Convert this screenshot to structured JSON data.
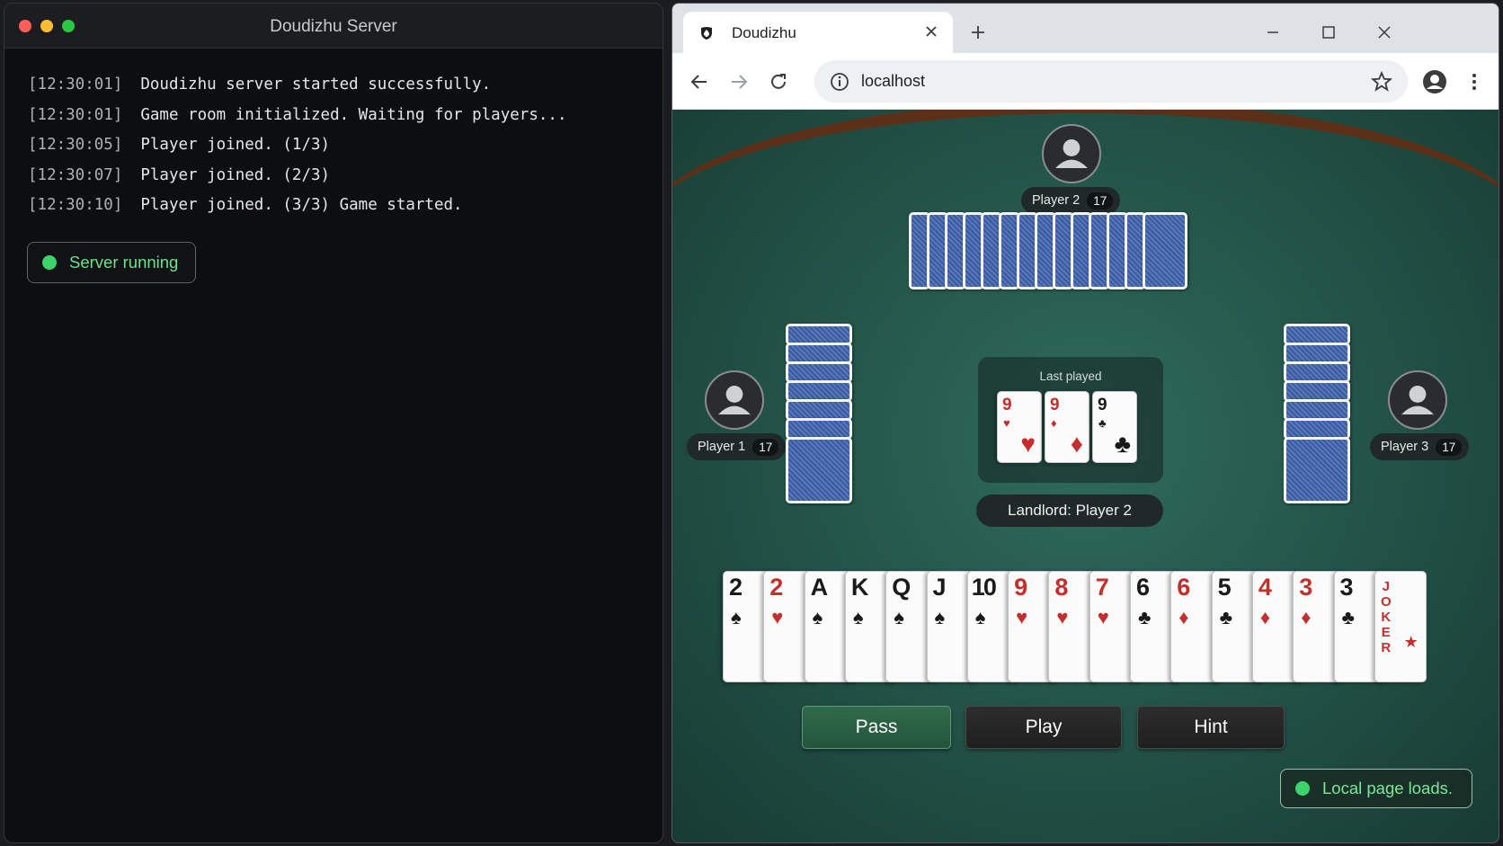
{
  "terminal": {
    "title": "Doudizhu Server",
    "log": [
      {
        "time": "[12:30:01]",
        "msg": "Doudizhu server started successfully."
      },
      {
        "time": "[12:30:01]",
        "msg": "Game room initialized. Waiting for players..."
      },
      {
        "time": "[12:30:05]",
        "msg": "Player joined. (1/3)"
      },
      {
        "time": "[12:30:07]",
        "msg": "Player joined. (2/3)"
      },
      {
        "time": "[12:30:10]",
        "msg": "Player joined. (3/3) Game started."
      }
    ],
    "status": "Server running",
    "status_color": "#3dd56a"
  },
  "browser": {
    "tab_title": "Doudizhu",
    "url": "localhost",
    "icons": [
      "back-icon",
      "forward-icon",
      "reload-icon",
      "info-icon",
      "star-icon",
      "profile-icon",
      "menu-icon"
    ]
  },
  "game": {
    "players": {
      "top": {
        "name": "Player 2",
        "count": "17"
      },
      "left": {
        "name": "Player 1",
        "count": "17"
      },
      "right": {
        "name": "Player 3",
        "count": "17"
      }
    },
    "last_played_label": "Last played",
    "last_played": [
      {
        "rank": "9",
        "suit": "♥",
        "color": "red"
      },
      {
        "rank": "9",
        "suit": "♦",
        "color": "red"
      },
      {
        "rank": "9",
        "suit": "♣",
        "color": "black"
      }
    ],
    "landlord": "Landlord: Player 2",
    "hand": [
      {
        "rank": "2",
        "suit": "♠",
        "color": "black"
      },
      {
        "rank": "2",
        "suit": "♥",
        "color": "red"
      },
      {
        "rank": "A",
        "suit": "♠",
        "color": "black"
      },
      {
        "rank": "K",
        "suit": "♠",
        "color": "black"
      },
      {
        "rank": "Q",
        "suit": "♠",
        "color": "black"
      },
      {
        "rank": "J",
        "suit": "♠",
        "color": "black"
      },
      {
        "rank": "10",
        "suit": "♠",
        "color": "black"
      },
      {
        "rank": "9",
        "suit": "♥",
        "color": "red"
      },
      {
        "rank": "8",
        "suit": "♥",
        "color": "red"
      },
      {
        "rank": "7",
        "suit": "♥",
        "color": "red"
      },
      {
        "rank": "6",
        "suit": "♣",
        "color": "black"
      },
      {
        "rank": "6",
        "suit": "♦",
        "color": "red"
      },
      {
        "rank": "5",
        "suit": "♣",
        "color": "black"
      },
      {
        "rank": "4",
        "suit": "♦",
        "color": "red"
      },
      {
        "rank": "3",
        "suit": "♦",
        "color": "red"
      },
      {
        "rank": "3",
        "suit": "♣",
        "color": "black"
      }
    ],
    "joker": {
      "text": "JOKER",
      "star": "★",
      "color": "red"
    },
    "buttons": {
      "pass": "Pass",
      "play": "Play",
      "hint": "Hint"
    },
    "load_status": "Local page loads."
  }
}
